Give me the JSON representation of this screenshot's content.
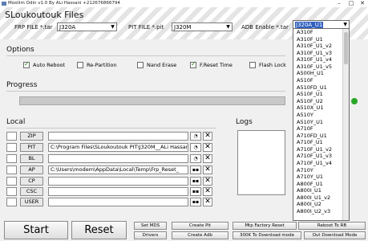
{
  "window": {
    "title": "Mosilim Odin v1.0 By ALi Hassani +212676866794",
    "minimize": "–",
    "maximize": "□",
    "close": "✕"
  },
  "header": {
    "app_title": "SLoukoutouk Files",
    "frp_file_label": "FRP FILE *.tar",
    "frp_file_value": "J320A",
    "pit_file_label": "PIT FILE *.pit",
    "pit_file_value": "J320M",
    "adb_label": "ADB Enable *.tar",
    "adb_value": "J320A_U1"
  },
  "options": {
    "title": "Options",
    "items": [
      {
        "label": "Auto Reboot",
        "checked": true
      },
      {
        "label": "Re-Partition",
        "checked": false
      },
      {
        "label": "Nand Erase",
        "checked": false
      },
      {
        "label": "F.Reset Time",
        "checked": true
      },
      {
        "label": "Flash Lock",
        "checked": false
      }
    ]
  },
  "progress": {
    "title": "Progress",
    "value": 0
  },
  "local": {
    "title": "Local",
    "rows": [
      {
        "button": "ZIP",
        "path": "",
        "icon": "spinner-icon"
      },
      {
        "button": "PIT",
        "path": "C:\\Program Files\\SLoukoutouk PIT\\J320M__ALi Hassani",
        "icon": "spinner-icon"
      },
      {
        "button": "BL",
        "path": "",
        "icon": "spinner-icon"
      },
      {
        "button": "AP",
        "path": "C:\\Users\\modem\\AppData\\Local\\Temp\\Frp_Reset_",
        "icon": "browse-icon"
      },
      {
        "button": "CP",
        "path": "",
        "icon": "browse-icon"
      },
      {
        "button": "CSC",
        "path": "",
        "icon": "browse-icon"
      },
      {
        "button": "USER",
        "path": "",
        "icon": "browse-icon"
      }
    ],
    "browse_glyph": "▪▪",
    "clear_glyph": "✕"
  },
  "logs": {
    "title": "Logs"
  },
  "buttons": {
    "start": "Start",
    "reset": "Reset",
    "set_mds": "Set MDS",
    "create_pit": "Create Pit",
    "drivers": "Drivers",
    "create_adb": "Create Adb",
    "mtp_factory_reset": "Mtp Factory Reset",
    "reboot_to_rb": "Reboot To RB",
    "to_download_300k": "300K To Download mode",
    "out_download_mode": "Out Download Mode"
  },
  "adb_dropdown": {
    "selected": "J320A_U1",
    "items": [
      "A310F",
      "A310F_U1",
      "A310F_U1_v2",
      "A310F_U1_v3",
      "A310F_U1_v4",
      "A310F_U1_v5",
      "A500H_U1",
      "A510F",
      "A510FD_U1",
      "A510F_U1",
      "A510F_U2",
      "A510X_U1",
      "A510Y",
      "A510Y_U1",
      "A710F",
      "A710FD_U1",
      "A710F_U1",
      "A710F_U1_v2",
      "A710F_U1_v3",
      "A710F_U1_v4",
      "A710Y",
      "A710Y_U1",
      "A800F_U1",
      "A800I_U1",
      "A800I_U1_v2",
      "A800I_U2",
      "A800I_U2_v3"
    ]
  }
}
